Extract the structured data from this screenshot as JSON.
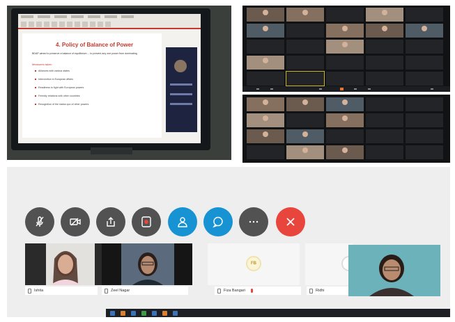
{
  "slide": {
    "title": "4. Policy of Balance of Power",
    "intro": "BDAP aimed to preserve a balance of equilibrium ... to prevent any one power from dominating",
    "subheading": "Measures taken",
    "bullets": [
      "Alliances with various states",
      "Intervention in European affairs",
      "Readiness to fight with European powers",
      "Friendly relations with other countries",
      "Recognition of the status quo of other powers"
    ]
  },
  "gallery_top": {
    "rows": [
      [
        "",
        "",
        "",
        "",
        ""
      ],
      [
        "",
        "",
        "",
        "",
        ""
      ],
      [
        "",
        "",
        "",
        "",
        ""
      ],
      [
        "",
        "",
        "",
        "",
        ""
      ],
      [
        "",
        "",
        "",
        "",
        ""
      ]
    ]
  },
  "gallery_bottom": {
    "rows": [
      [
        "",
        "",
        "",
        "",
        ""
      ],
      [
        "",
        "",
        "",
        "",
        ""
      ],
      [
        "",
        "",
        "",
        "",
        ""
      ],
      [
        "",
        "",
        "",
        "",
        ""
      ]
    ]
  },
  "call": {
    "controls": [
      {
        "name": "mic-button",
        "icon": "mic-off-icon",
        "color": "#525252"
      },
      {
        "name": "camera-button",
        "icon": "camera-icon",
        "color": "#525252"
      },
      {
        "name": "share-button",
        "icon": "share-icon",
        "color": "#525252"
      },
      {
        "name": "record-button",
        "icon": "record-icon",
        "color": "#525252"
      },
      {
        "name": "participants-button",
        "icon": "person-icon",
        "color": "#1793d4"
      },
      {
        "name": "chat-button",
        "icon": "chat-icon",
        "color": "#1793d4"
      },
      {
        "name": "more-button",
        "icon": "more-icon",
        "color": "#525252"
      },
      {
        "name": "end-call-button",
        "icon": "close-icon",
        "color": "#e8453c"
      }
    ],
    "participants": [
      {
        "name": "Ishita"
      },
      {
        "name": "Zeel Nagar"
      },
      {
        "name": "Fiza Bangari",
        "initials": "FB"
      },
      {
        "name": "Ridhi"
      }
    ]
  }
}
